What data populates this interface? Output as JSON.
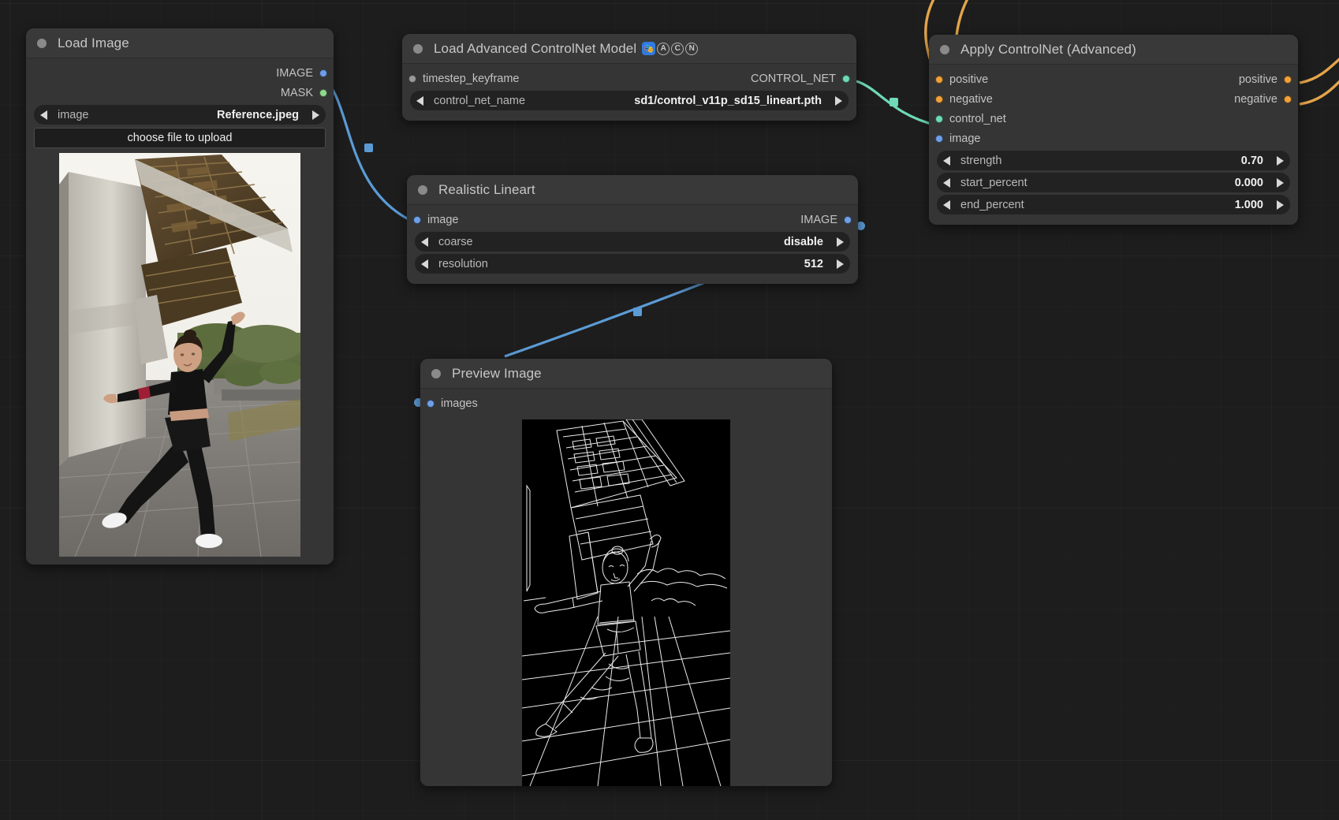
{
  "app": {
    "canvas_bg": "#1d1d1d"
  },
  "colors": {
    "image_slot": "#6f9fe8",
    "mask_slot": "#8fd98f",
    "controlnet_slot": "#6fd9b8",
    "conditioning_slot": "#f1a13a",
    "link_image": "#5b9bd5",
    "link_controlnet": "#6fd9b8",
    "link_conditioning": "#e3a44a"
  },
  "nodes": {
    "load_image": {
      "title": "Load Image",
      "outputs": [
        {
          "label": "IMAGE",
          "color": "#6f9fe8"
        },
        {
          "label": "MASK",
          "color": "#8fd98f"
        }
      ],
      "widgets": [
        {
          "name": "image",
          "value": "Reference.jpeg",
          "type": "combo"
        }
      ],
      "button": "choose file to upload",
      "preview_alt": "Reference photo: dancer posing beneath a concrete overpass"
    },
    "load_controlnet": {
      "title": "Load Advanced ControlNet Model",
      "badges": [
        "🎭",
        "A",
        "C",
        "N"
      ],
      "inputs": [
        {
          "label": "timestep_keyframe",
          "color": "#9a9a9a"
        }
      ],
      "outputs": [
        {
          "label": "CONTROL_NET",
          "color": "#6fd9b8"
        }
      ],
      "widgets": [
        {
          "name": "control_net_name",
          "value": "sd1/control_v11p_sd15_lineart.pth",
          "type": "combo"
        }
      ]
    },
    "realistic_lineart": {
      "title": "Realistic Lineart",
      "inputs": [
        {
          "label": "image",
          "color": "#6f9fe8"
        }
      ],
      "outputs": [
        {
          "label": "IMAGE",
          "color": "#6f9fe8"
        }
      ],
      "widgets": [
        {
          "name": "coarse",
          "value": "disable",
          "type": "combo"
        },
        {
          "name": "resolution",
          "value": "512",
          "type": "number"
        }
      ]
    },
    "apply_controlnet": {
      "title": "Apply ControlNet (Advanced)",
      "inputs": [
        {
          "label": "positive",
          "color": "#f1a13a"
        },
        {
          "label": "negative",
          "color": "#f1a13a"
        },
        {
          "label": "control_net",
          "color": "#6fd9b8"
        },
        {
          "label": "image",
          "color": "#6f9fe8"
        }
      ],
      "outputs": [
        {
          "label": "positive",
          "color": "#f1a13a"
        },
        {
          "label": "negative",
          "color": "#f1a13a"
        }
      ],
      "widgets": [
        {
          "name": "strength",
          "value": "0.70",
          "type": "number"
        },
        {
          "name": "start_percent",
          "value": "0.000",
          "type": "number"
        },
        {
          "name": "end_percent",
          "value": "1.000",
          "type": "number"
        }
      ]
    },
    "preview_image": {
      "title": "Preview Image",
      "inputs": [
        {
          "label": "images",
          "color": "#6f9fe8"
        }
      ],
      "preview_alt": "White line-art edge map of the dancer under the overpass"
    }
  }
}
